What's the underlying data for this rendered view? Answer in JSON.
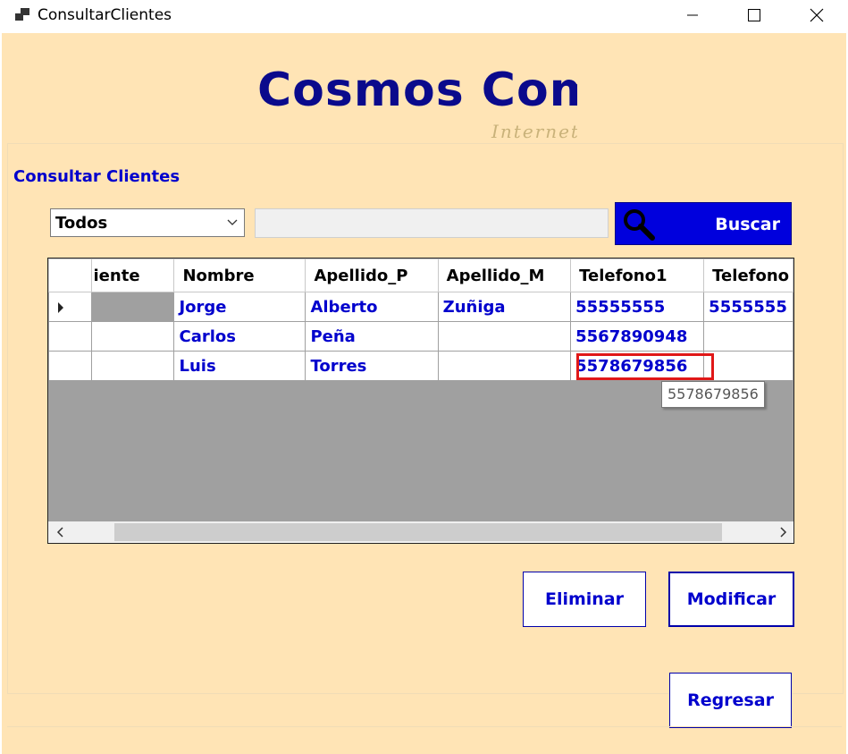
{
  "window": {
    "title": "ConsultarClientes",
    "controls": [
      "minimize-icon",
      "maximize-icon",
      "close-icon"
    ]
  },
  "logo": {
    "main_text": "Cosmos Com",
    "sub_text": "Internet"
  },
  "group": {
    "title": "Consultar Clientes"
  },
  "filter": {
    "selected": "Todos",
    "search_value": ""
  },
  "buscar_button": {
    "label": "Buscar",
    "icon": "magnifier-icon"
  },
  "grid": {
    "columns": [
      "iente",
      "Nombre",
      "Apellido_P",
      "Apellido_M",
      "Telefono1",
      "Telefono"
    ],
    "rows": [
      [
        "",
        "Jorge",
        "Alberto",
        "Zuñiga",
        "55555555",
        "5555555"
      ],
      [
        "",
        "Carlos",
        "Peña",
        "",
        "5567890948",
        ""
      ],
      [
        "",
        "Luis",
        "Torres",
        "",
        "5578679856",
        ""
      ]
    ]
  },
  "tooltip": {
    "text": "5578679856"
  },
  "buttons": {
    "eliminar": "Eliminar",
    "modificar": "Modificar",
    "regresar": "Regresar"
  },
  "colors": {
    "background": "#ffe4b5",
    "accent": "#0000cd",
    "buscar_bg": "#0000dd",
    "highlight": "#e01818"
  }
}
